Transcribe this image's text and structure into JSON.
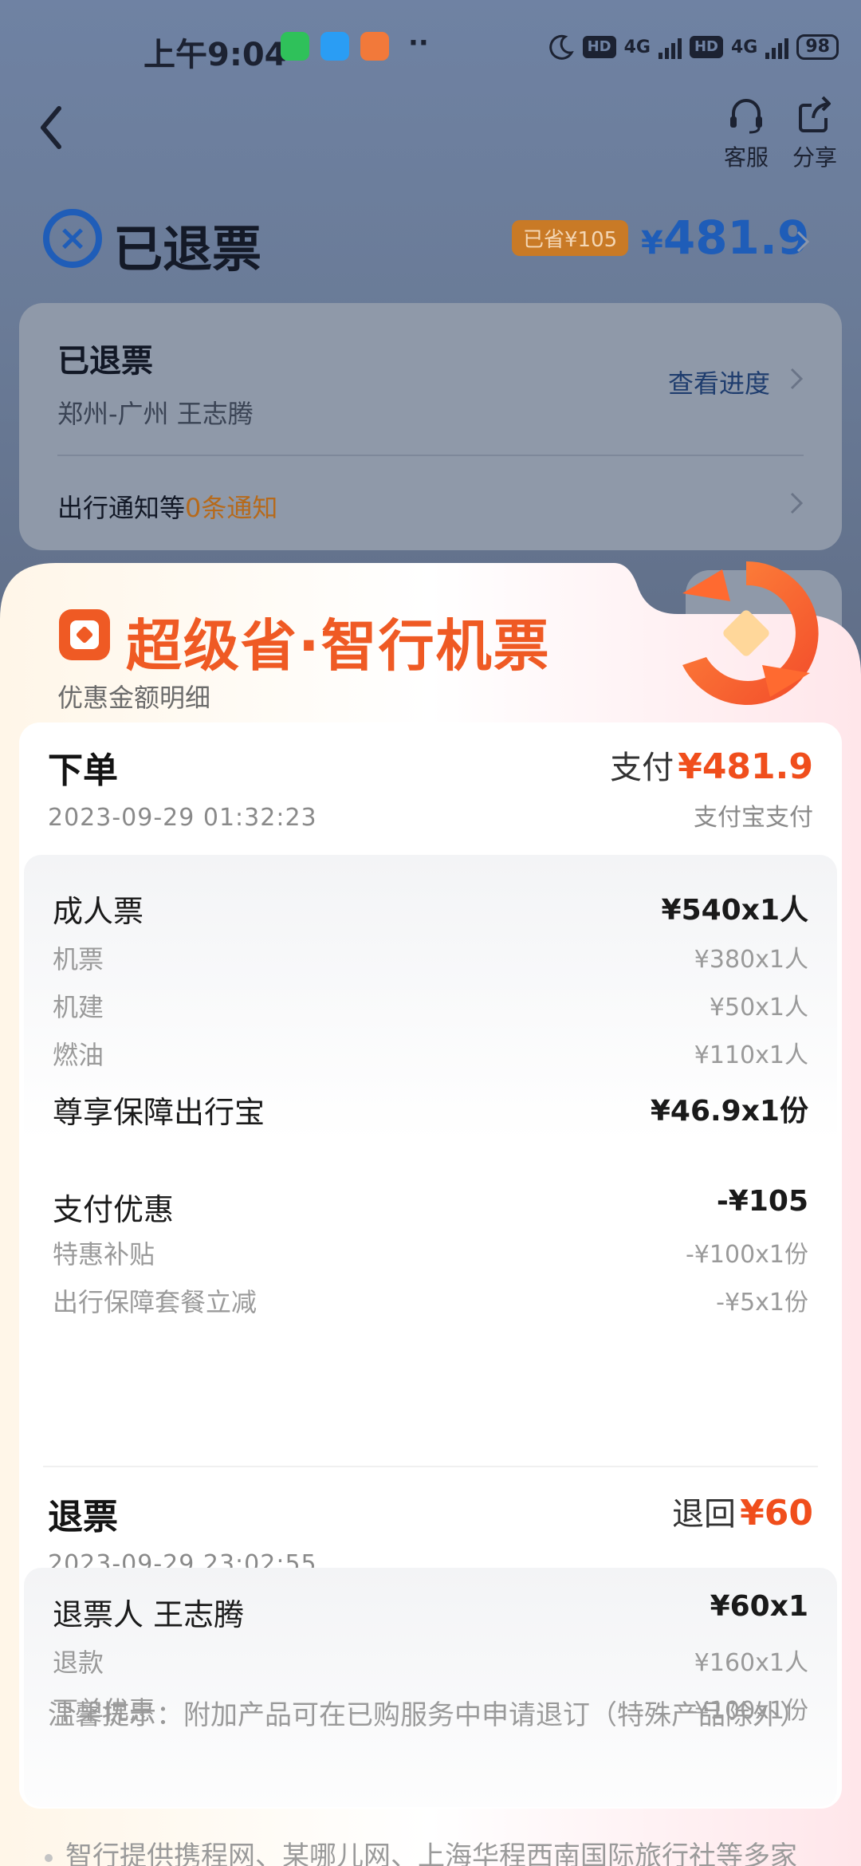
{
  "status_bar": {
    "time": "上午9:04",
    "dots": "··",
    "hd1": "HD",
    "net1": "4G",
    "hd2": "HD",
    "net2": "4G",
    "battery": "98"
  },
  "header": {
    "service_label": "客服",
    "share_label": "分享"
  },
  "status": {
    "icon": "x-circle-icon",
    "title": "已退票",
    "saved_badge": "已省¥105",
    "currency": "¥",
    "amount": "481.9"
  },
  "order_card": {
    "title": "已退票",
    "route": "郑州-广州  王志腾",
    "progress_label": "查看进度",
    "notify_prefix": "出行通知等",
    "notify_count": "0条通知"
  },
  "sheet": {
    "brand_title": "超级省·智行机票",
    "subtitle": "优惠金额明细",
    "order": {
      "title": "下单",
      "datetime": "2023-09-29 01:32:23",
      "pay_label": "支付",
      "pay_amount": "¥481.9",
      "pay_method": "支付宝支付"
    },
    "items": {
      "adult_label": "成人票",
      "adult_value": "¥540x1人",
      "ticket_label": "机票",
      "ticket_value": "¥380x1人",
      "airport_label": "机建",
      "airport_value": "¥50x1人",
      "fuel_label": "燃油",
      "fuel_value": "¥110x1人",
      "insurance_label": "尊享保障出行宝",
      "insurance_value": "¥46.9x1份",
      "discount_label": "支付优惠",
      "discount_value": "-¥105",
      "subsidy_label": "特惠补贴",
      "subsidy_value": "-¥100x1份",
      "package_label": "出行保障套餐立减",
      "package_value": "-¥5x1份"
    },
    "refund": {
      "title": "退票",
      "datetime": "2023-09-29 23:02:55",
      "return_label": "退回",
      "return_amount": "¥60",
      "person_label": "退票人  王志腾",
      "person_value": "¥60x1",
      "refund_label": "退款",
      "refund_value": "¥160x1人",
      "order_discount_label": "下单优惠",
      "order_discount_value": "-¥100x1份",
      "tip": "温馨提示：附加产品可在已购服务中申请退订（特殊产品除外）"
    },
    "footer_note": "智行提供携程网、某哪儿网、上海华程西南国际旅行社等多家"
  },
  "colors": {
    "accent_blue": "#1f5db8",
    "accent_orange": "#ef5a24",
    "badge_orange": "#c97a26"
  }
}
